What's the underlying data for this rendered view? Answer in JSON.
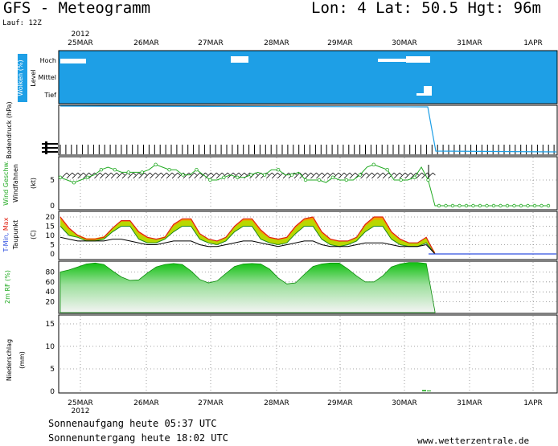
{
  "header": {
    "title": "GFS - Meteogramm",
    "location": "Lon: 4 Lat: 50.5 Hgt: 96m",
    "run": "Lauf: 12Z",
    "year": "2012"
  },
  "footer": {
    "sunrise": "Sonnenaufgang heute 05:37 UTC",
    "sunset": "Sonnenuntergang heute 18:02 UTC",
    "site": "www.wetterzentrale.de"
  },
  "colors": {
    "cloud_bg": "#1e9fe6",
    "pressure_line": "#1e9fe6",
    "wind_gust": "#22aa22",
    "temp_max": "#e02010",
    "temp_band_top": "#f0a000",
    "temp_band_bottom": "#b8d800",
    "dewpoint": "#000000",
    "humidity_fill": "#20d020",
    "grid": "#888888"
  },
  "chart_data": [
    {
      "type": "area",
      "panel": "clouds",
      "title": "Wolken (%)",
      "ylabel": "Level",
      "levels": [
        "Hoch",
        "Mittel",
        "Tief"
      ],
      "note": "white blocks indicate cloud cover"
    },
    {
      "type": "line",
      "panel": "pressure",
      "ylabel": "Bodendruck (hPa)"
    },
    {
      "type": "line",
      "panel": "wind",
      "ylabel": "Wind Geschw. Windfahnen (kt)",
      "ylim": [
        0,
        8
      ],
      "yticks": [
        0,
        5
      ],
      "series": [
        {
          "name": "Wind Geschw.",
          "values": [
            5.5,
            5,
            4.5,
            5,
            5.5,
            6,
            7,
            7.5,
            7,
            6.5,
            6.5,
            6.5,
            6.5,
            7,
            8,
            7.5,
            7,
            7,
            6,
            6,
            7,
            6,
            5,
            5,
            5.5,
            6,
            5.5,
            5.5,
            6,
            6.5,
            6,
            7,
            7,
            6,
            6,
            6.5,
            5,
            5,
            5,
            4.5,
            5.5,
            5,
            5,
            5,
            6,
            7.5,
            8,
            7.5,
            7,
            5,
            5,
            5,
            5.5,
            7.5,
            5,
            0
          ]
        }
      ]
    },
    {
      "type": "area",
      "panel": "temperature",
      "ylabel": "T-Min, Max Taupunkt (C)",
      "ylim": [
        -1,
        22
      ],
      "yticks": [
        0,
        5,
        10,
        15,
        20
      ],
      "series": [
        {
          "name": "Max",
          "values": [
            20,
            14,
            10,
            8,
            8,
            9,
            14,
            18,
            18,
            12,
            9,
            8,
            9,
            16,
            19,
            19,
            11,
            8,
            7,
            9,
            15,
            19,
            19,
            13,
            9,
            8,
            9,
            15,
            19,
            20,
            12,
            8,
            7,
            7,
            9,
            16,
            20,
            20,
            12,
            8,
            6,
            6,
            9,
            0
          ]
        },
        {
          "name": "Min",
          "values": [
            15,
            10,
            9,
            7,
            7,
            8,
            12,
            15,
            15,
            8,
            6,
            6,
            8,
            12,
            15,
            15,
            8,
            6,
            5,
            7,
            12,
            15,
            15,
            8,
            6,
            5,
            6,
            11,
            15,
            15,
            8,
            5,
            4,
            5,
            7,
            12,
            15,
            15,
            8,
            5,
            4,
            4,
            6,
            0
          ]
        },
        {
          "name": "Taupunkt",
          "values": [
            9,
            8,
            7,
            7,
            7,
            7,
            8,
            8,
            7,
            6,
            5,
            5,
            6,
            7,
            7,
            7,
            5,
            4,
            4,
            5,
            6,
            7,
            7,
            6,
            5,
            4,
            5,
            6,
            7,
            7,
            5,
            4,
            4,
            4,
            5,
            6,
            6,
            6,
            5,
            4,
            4,
            4,
            5,
            0
          ]
        }
      ]
    },
    {
      "type": "area",
      "panel": "humidity",
      "ylabel": "2m RF (%)",
      "ylim": [
        5,
        100
      ],
      "yticks": [
        20,
        40,
        60,
        80
      ],
      "series": [
        {
          "name": "2m RF",
          "values": [
            80,
            84,
            90,
            96,
            98,
            95,
            82,
            70,
            63,
            64,
            78,
            90,
            95,
            97,
            95,
            82,
            65,
            58,
            62,
            77,
            91,
            96,
            97,
            96,
            86,
            68,
            56,
            58,
            75,
            91,
            96,
            98,
            98,
            86,
            72,
            60,
            60,
            72,
            90,
            96,
            99,
            99,
            97,
            0
          ]
        }
      ]
    },
    {
      "type": "bar",
      "panel": "precipitation",
      "ylabel": "Niederschlag (mm)",
      "ylim": [
        0,
        16
      ],
      "yticks": [
        0,
        5,
        10,
        15
      ],
      "series": [
        {
          "name": "Niederschlag",
          "values": [
            0.3,
            0.2
          ]
        }
      ]
    }
  ],
  "x_axis": {
    "top_labels": [
      "25MAR",
      "26MAR",
      "27MAR",
      "28MAR",
      "29MAR",
      "30MAR",
      "31MAR",
      "1APR"
    ],
    "bottom_labels": [
      "25MAR",
      "26MAR",
      "27MAR",
      "28MAR",
      "29MAR",
      "30MAR",
      "31MAR",
      "1APR"
    ],
    "year_label": "2012"
  }
}
